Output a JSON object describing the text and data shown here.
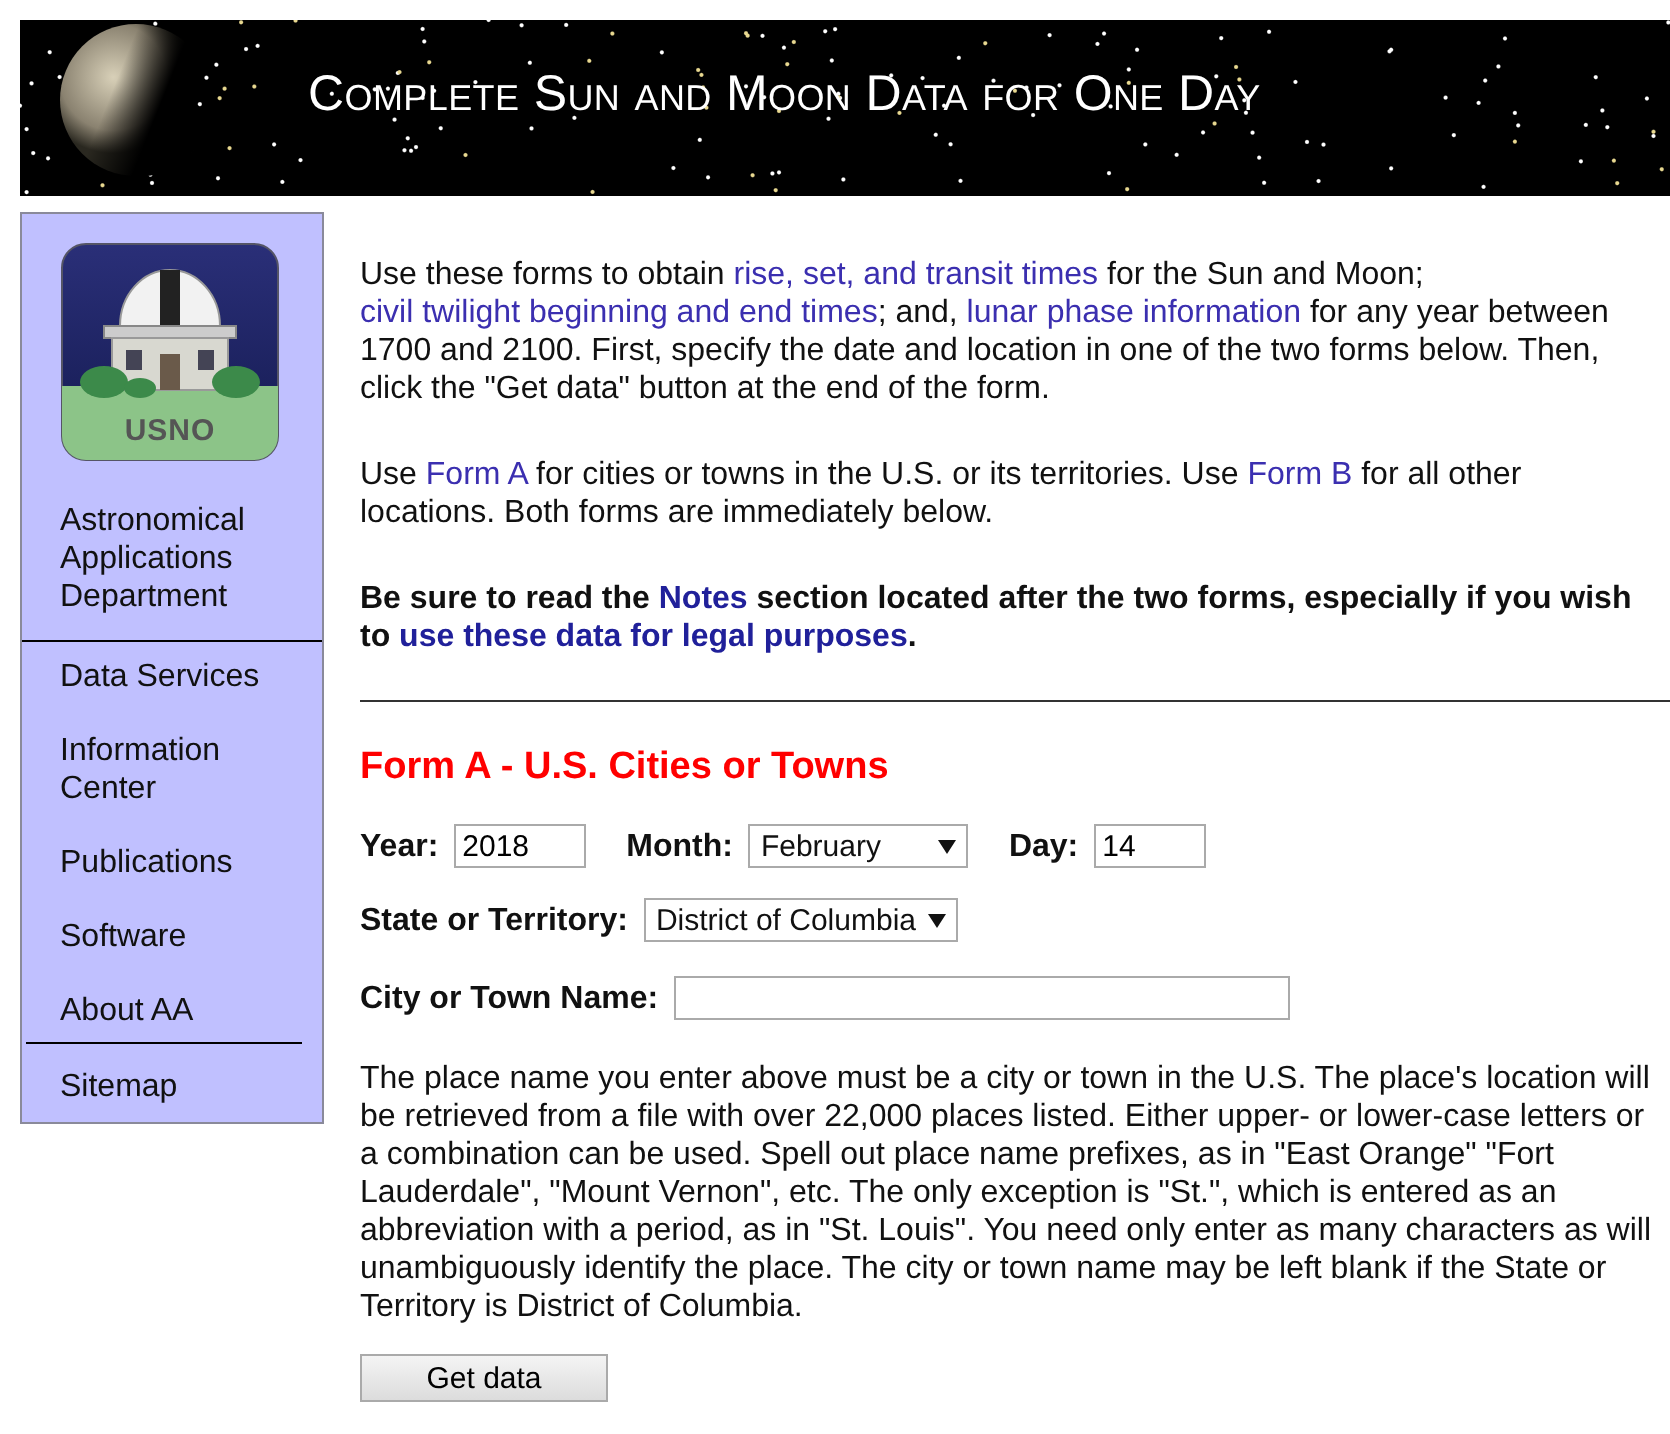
{
  "banner": {
    "title": "Complete Sun and Moon Data for One Day"
  },
  "sidebar": {
    "logo_text": "USNO",
    "department": "Astronomical Applications Department",
    "items": [
      {
        "label": "Data Services"
      },
      {
        "label": "Information Center"
      },
      {
        "label": "Publications"
      },
      {
        "label": "Software"
      },
      {
        "label": "About AA"
      }
    ],
    "footer_items": [
      {
        "label": "Sitemap"
      }
    ]
  },
  "intro": [
    {
      "bold": false,
      "segments": [
        {
          "text": "Use these forms to obtain ",
          "link": false
        },
        {
          "text": "rise, set, and transit times",
          "link": true
        },
        {
          "text": " for the Sun and Moon; ",
          "link": false
        },
        {
          "text": "civil twilight beginning and end times",
          "link": true
        },
        {
          "text": "; and, ",
          "link": false
        },
        {
          "text": "lunar phase information",
          "link": true
        },
        {
          "text": " for any year between 1700 and 2100. First, specify the date and location in one of the two forms below. Then, click the \"Get data\" button at the end of the form.",
          "link": false
        }
      ]
    },
    {
      "bold": false,
      "segments": [
        {
          "text": "Use ",
          "link": false
        },
        {
          "text": "Form A",
          "link": true
        },
        {
          "text": " for cities or towns in the U.S. or its territories. Use ",
          "link": false
        },
        {
          "text": "Form B",
          "link": true
        },
        {
          "text": " for all other locations. Both forms are immediately below.",
          "link": false
        }
      ]
    },
    {
      "bold": true,
      "segments": [
        {
          "text": "Be sure to read the ",
          "link": false
        },
        {
          "text": "Notes",
          "link": true
        },
        {
          "text": " section located after the two forms, especially if you wish to ",
          "link": false
        },
        {
          "text": "use these data for legal purposes",
          "link": true
        },
        {
          "text": ".",
          "link": false
        }
      ]
    }
  ],
  "form_a": {
    "title": "Form A - U.S. Cities or Towns",
    "year": {
      "label": "Year:",
      "value": "2018"
    },
    "month": {
      "label": "Month:",
      "value": "February"
    },
    "day": {
      "label": "Day:",
      "value": "14"
    },
    "state": {
      "label": "State or Territory:",
      "value": "District of Columbia"
    },
    "city": {
      "label": "City or Town Name:"
    },
    "note": "The place name you enter above must be a city or town in the U.S. The place's location will be retrieved from a file with over 22,000 places listed. Either upper- or lower-case letters or a combination can be used. Spell out place name prefixes, as in \"East Orange\" \"Fort Lauderdale\", \"Mount Vernon\", etc. The only exception is \"St.\", which is entered as an abbreviation with a period, as in \"St. Louis\". You need only enter as many characters as will unambiguously identify the place. The city or town name may be left blank if the State or Territory is District of Columbia.",
    "submit": "Get data"
  }
}
